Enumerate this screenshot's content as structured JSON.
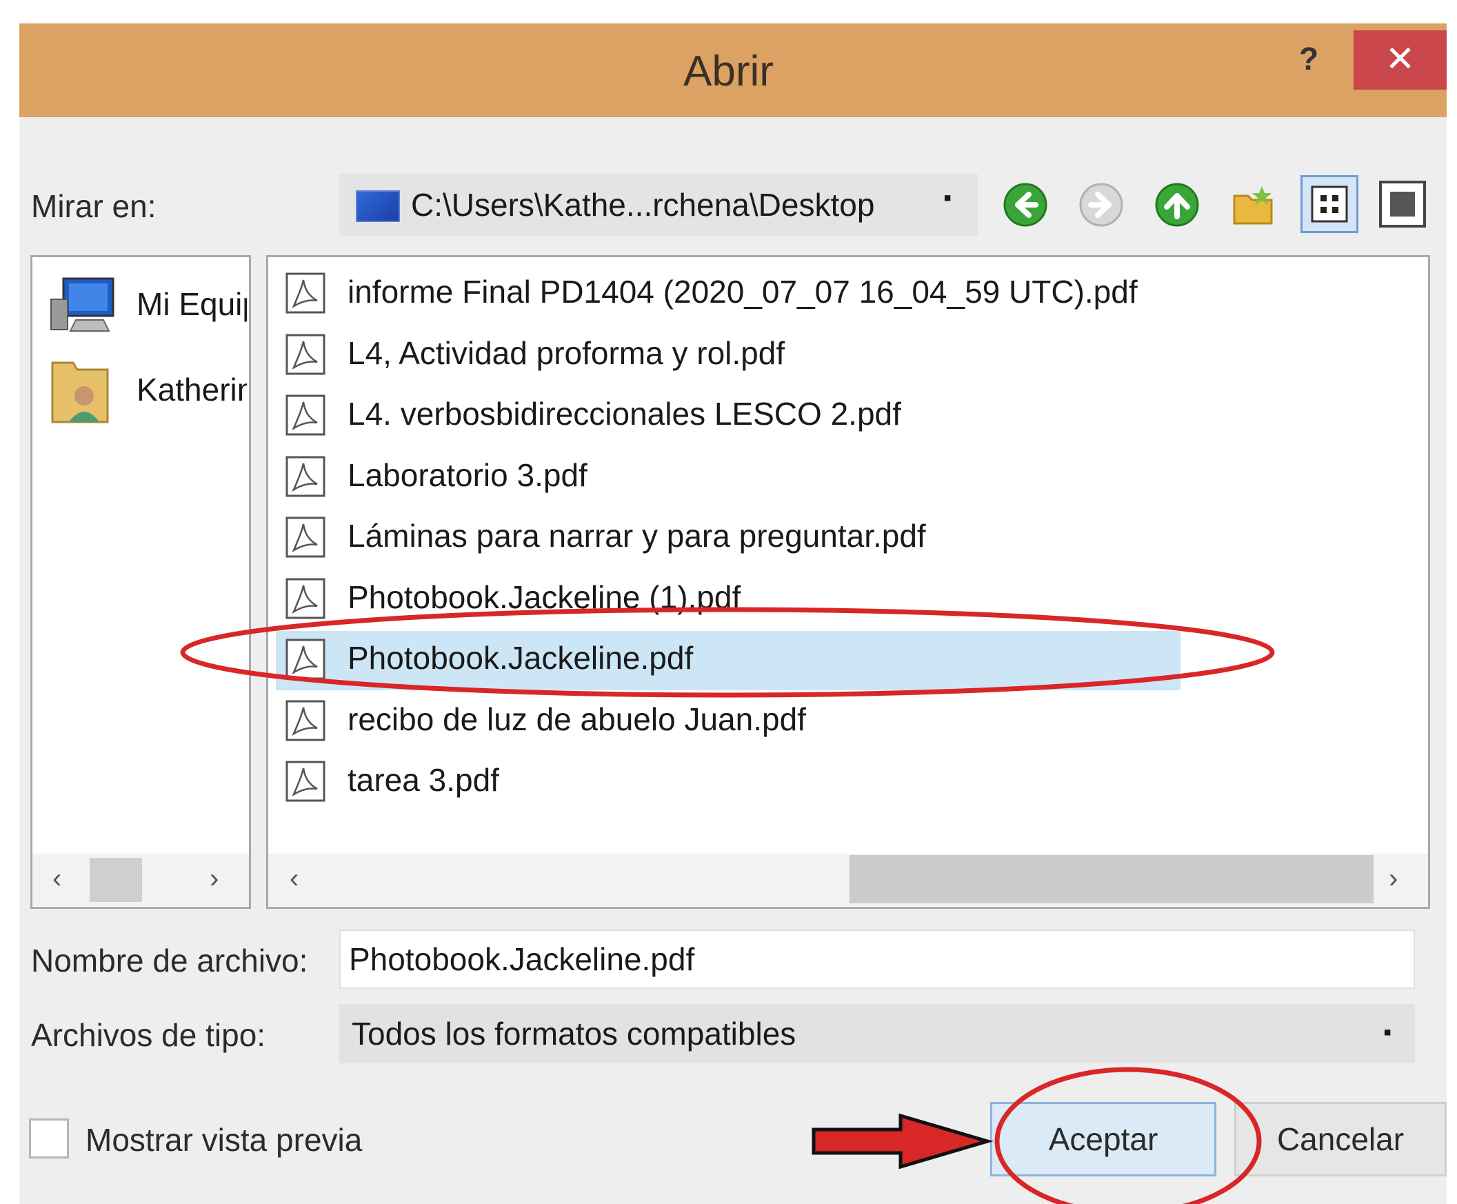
{
  "dialog": {
    "title": "Abrir",
    "help_label": "?",
    "close_label": "✕"
  },
  "look_in": {
    "label": "Mirar en:",
    "path": "C:\\Users\\Kathe...rchena\\Desktop",
    "dropdown_glyph": "▪"
  },
  "toolbar": {
    "icons": [
      "back-icon",
      "forward-icon",
      "up-folder-icon",
      "new-folder-icon",
      "view-grid-icon",
      "preview-pane-icon"
    ]
  },
  "nav": {
    "items": [
      {
        "label": "Mi Equipo",
        "icon": "computer-icon"
      },
      {
        "label": "Katherine",
        "icon": "user-folder-icon"
      }
    ]
  },
  "files": [
    {
      "name": "informe Final PD1404 (2020_07_07 16_04_59 UTC).pdf",
      "selected": false
    },
    {
      "name": "L4, Actividad proforma y rol.pdf",
      "selected": false
    },
    {
      "name": "L4. verbosbidireccionales LESCO 2.pdf",
      "selected": false
    },
    {
      "name": "Laboratorio 3.pdf",
      "selected": false
    },
    {
      "name": "Láminas para narrar y para preguntar.pdf",
      "selected": false
    },
    {
      "name": "Photobook.Jackeline (1).pdf",
      "selected": false
    },
    {
      "name": "Photobook.Jackeline.pdf",
      "selected": true
    },
    {
      "name": "recibo de luz de abuelo Juan.pdf",
      "selected": false
    },
    {
      "name": "tarea 3.pdf",
      "selected": false
    }
  ],
  "fields": {
    "filename_label": "Nombre de archivo:",
    "filename_value": "Photobook.Jackeline.pdf",
    "filetype_label": "Archivos de tipo:",
    "filetype_value": "Todos los formatos compatibles"
  },
  "preview": {
    "label": "Mostrar vista previa",
    "checked": false
  },
  "buttons": {
    "accept": "Aceptar",
    "cancel": "Cancelar"
  },
  "annotations": {
    "highlight_color": "#d92626",
    "arrow_color": "#d92626"
  }
}
